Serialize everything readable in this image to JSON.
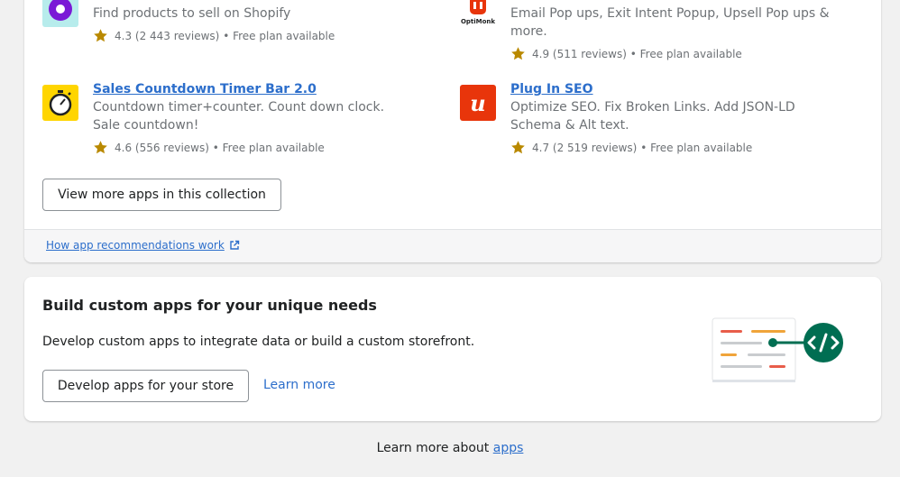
{
  "apps": [
    {
      "name": "",
      "description": "Find products to sell on Shopify",
      "rating": "4.3 (2 443 reviews)",
      "plan": "Free plan available",
      "icon": "purple-circle-icon"
    },
    {
      "name": "",
      "description": "Email Pop ups, Exit Intent Popup, Upsell Pop ups & more.",
      "rating": "4.9 (511 reviews)",
      "plan": "Free plan available",
      "icon": "optimonk-logo",
      "icon_label": "OptiMonk"
    },
    {
      "name": "Sales Countdown Timer Bar 2.0",
      "description": "Countdown timer+counter. Count down clock. Sale countdown!",
      "rating": "4.6 (556 reviews)",
      "plan": "Free plan available",
      "icon": "stopwatch-icon"
    },
    {
      "name": "Plug In SEO",
      "description": "Optimize SEO. Fix Broken Links. Add JSON-LD Schema & Alt text.",
      "rating": "4.7 (2 519 reviews)",
      "plan": "Free plan available",
      "icon": "plug-in-seo-logo",
      "icon_label": "u"
    }
  ],
  "collection_button": "View more apps in this collection",
  "recommendations_link": "How app recommendations work",
  "custom_apps": {
    "title": "Build custom apps for your unique needs",
    "description": "Develop custom apps to integrate data or build a custom storefront.",
    "develop_button": "Develop apps for your store",
    "learn_more": "Learn more"
  },
  "footer": {
    "prefix": "Learn more about ",
    "link": "apps"
  },
  "colors": {
    "link": "#2c6ecb",
    "star": "#b98900",
    "code_badge": "#006e52",
    "seo_red": "#e8350b"
  }
}
